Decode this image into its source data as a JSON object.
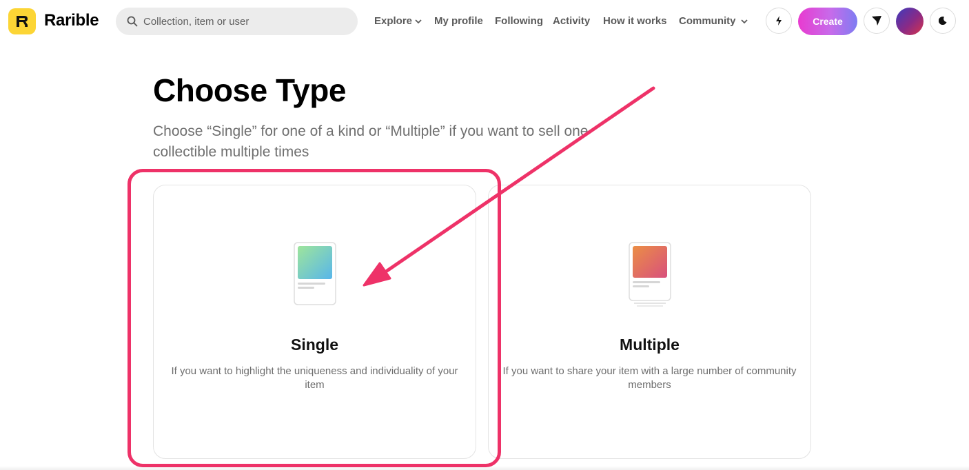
{
  "header": {
    "brand": "Rarible",
    "search_placeholder": "Collection, item or user",
    "nav": {
      "explore": "Explore",
      "my_profile": "My profile",
      "following": "Following",
      "activity": "Activity",
      "how_it_works": "How it works",
      "community": "Community"
    },
    "create_label": "Create",
    "colors": {
      "logo_bg": "#fcd535",
      "create_gradient": [
        "#e83bd0",
        "#7e7cf2"
      ]
    },
    "icons": [
      "logo-icon",
      "search-icon",
      "chevron-down-icon",
      "lightning-icon",
      "send-icon",
      "avatar",
      "moon-icon"
    ]
  },
  "main": {
    "title": "Choose Type",
    "subtitle": "Choose “Single” for one of a kind or “Multiple” if you want to sell one collectible multiple times",
    "options": [
      {
        "title": "Single",
        "description": "If you want to highlight the uniqueness and individuality of your item"
      },
      {
        "title": "Multiple",
        "description": "If you want to share your item with a large number of community members"
      }
    ]
  },
  "annotation": {
    "highlight_color": "#ee3268",
    "highlighted_option": "Single"
  }
}
